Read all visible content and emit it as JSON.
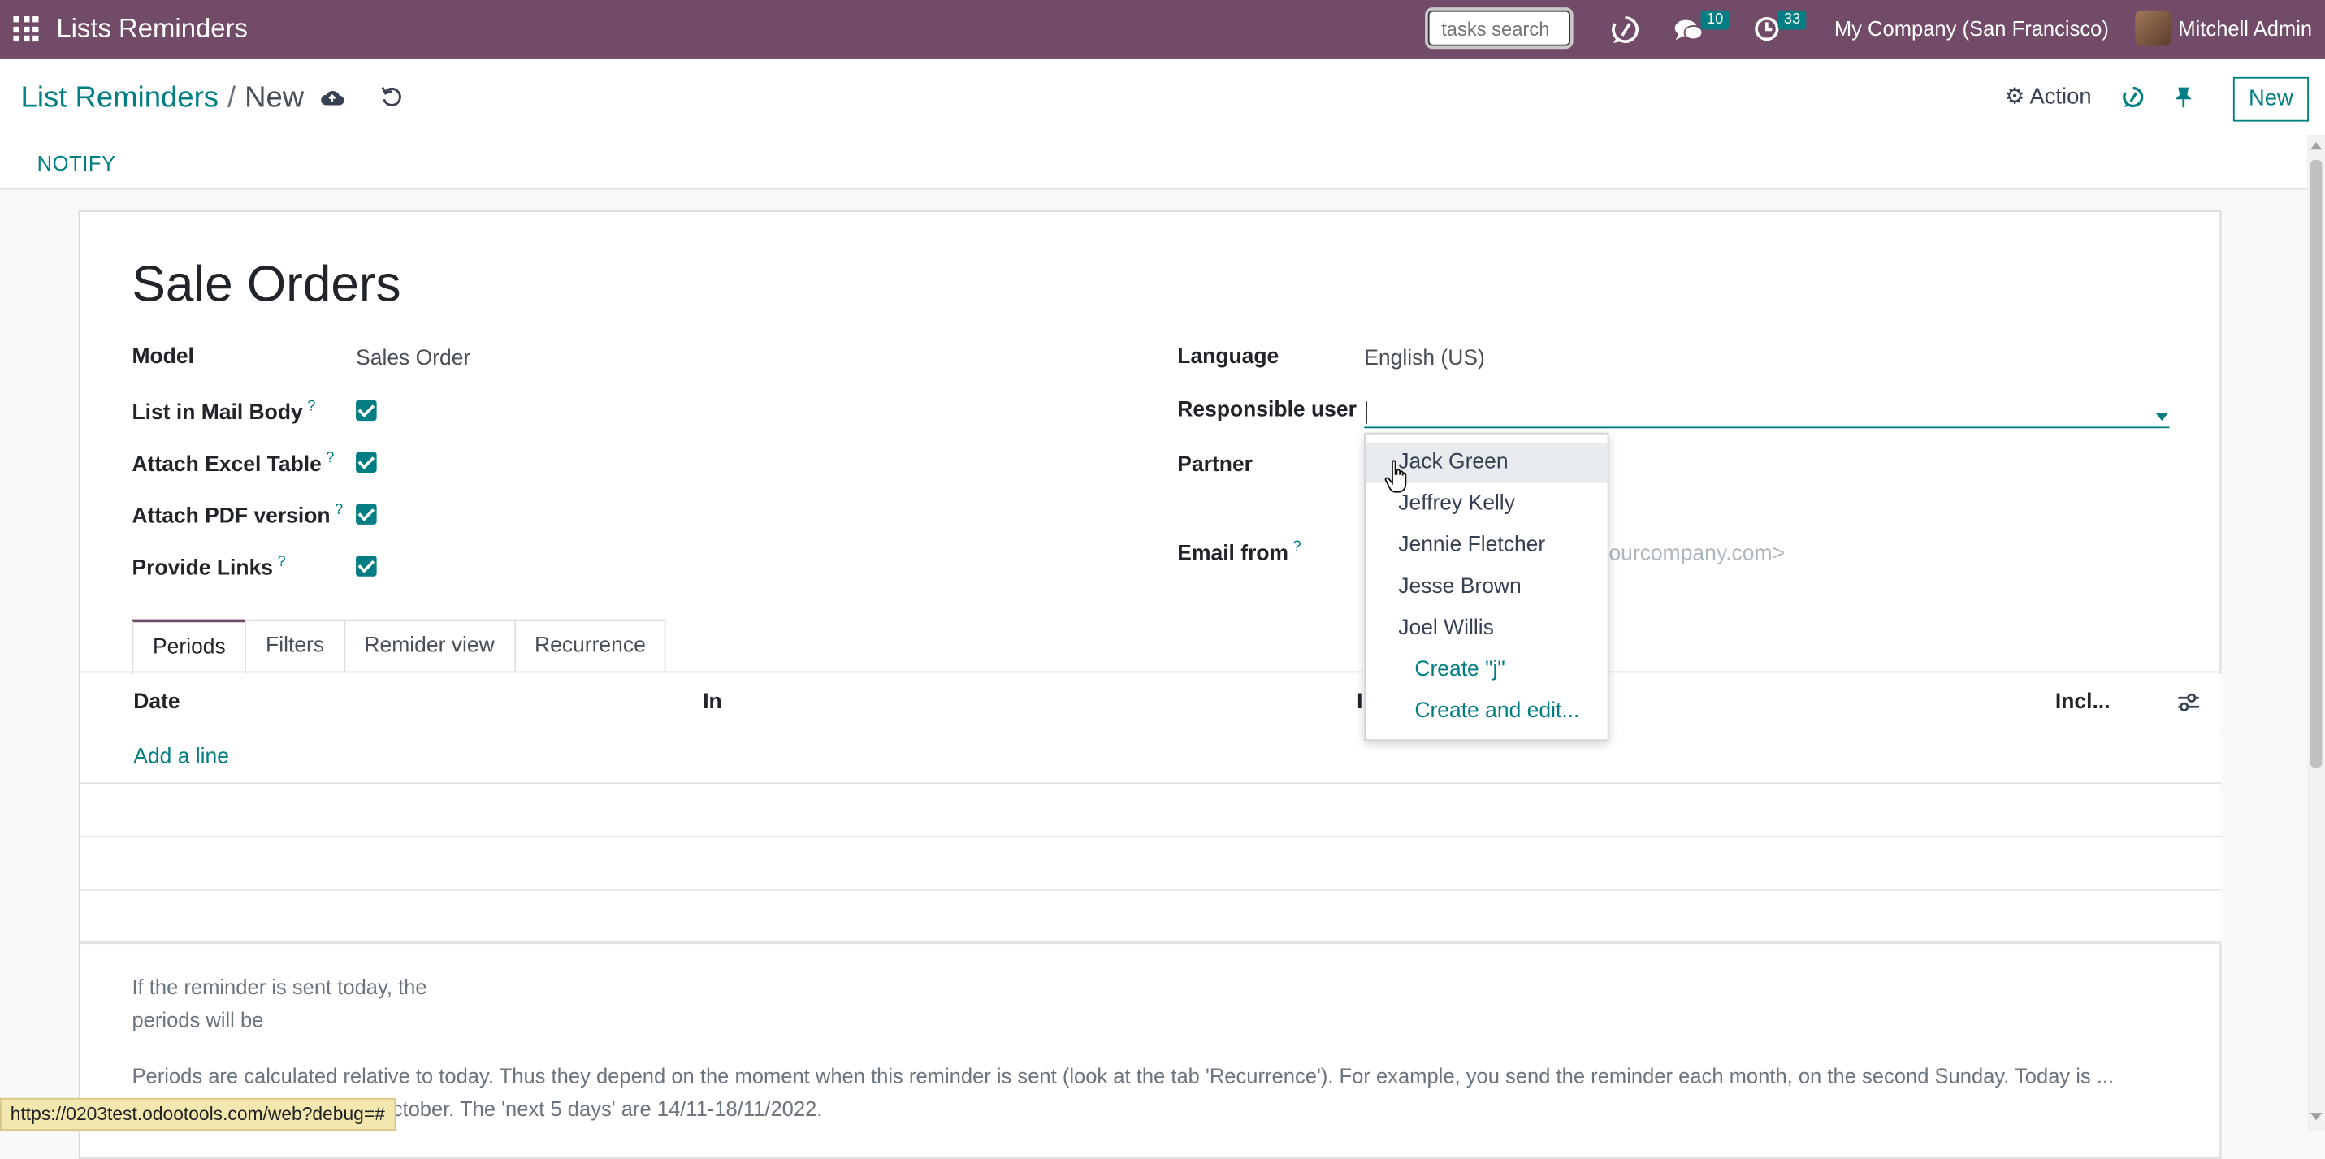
{
  "navbar": {
    "app_title": "Lists Reminders",
    "search_placeholder": "tasks search",
    "messages_count": "10",
    "activities_count": "33",
    "company": "My Company (San Francisco)",
    "user_name": "Mitchell Admin",
    "background_color": "#714b67"
  },
  "control_panel": {
    "breadcrumb_parent": "List Reminders",
    "breadcrumb_separator": "/",
    "breadcrumb_current": "New",
    "action_label": "Action",
    "new_label": "New"
  },
  "statusbar": {
    "notify_label": "NOTIFY"
  },
  "form": {
    "title": "Sale Orders",
    "fields": {
      "model_label": "Model",
      "model_value": "Sales Order",
      "list_in_mail_body_label": "List in Mail Body",
      "attach_excel_label": "Attach Excel Table",
      "attach_pdf_label": "Attach PDF version",
      "provide_links_label": "Provide Links",
      "help_mark": "?",
      "language_label": "Language",
      "language_value": "English (US)",
      "responsible_user_label": "Responsible user",
      "responsible_user_value": "j",
      "partner_label": "Partner",
      "email_from_label": "Email from",
      "email_from_placeholder": "ourcompany.com>"
    },
    "checkboxes": {
      "list_in_mail_body": true,
      "attach_excel": true,
      "attach_pdf": true,
      "provide_links": true
    }
  },
  "tabs": [
    "Periods",
    "Filters",
    "Remider view",
    "Recurrence"
  ],
  "active_tab": "Periods",
  "table": {
    "columns": [
      "Date",
      "In",
      "I",
      "Incl..."
    ],
    "add_line_label": "Add a line"
  },
  "notes": {
    "periods_intro": "If the reminder is sent today, the periods will be",
    "periods_explanation": "Periods are calculated relative to today. Thus they depend on the moment when this reminder is sent (look at the tab 'Recurrence'). For example, you send the reminder each month, on the second Sunday. Today is ... onths' are September and October. The 'next 5 days' are 14/11-18/11/2022."
  },
  "dropdown": {
    "options": [
      "Jack Green",
      "Jeffrey Kelly",
      "Jennie Fletcher",
      "Jesse Brown",
      "Joel Willis"
    ],
    "create_label": "Create \"j\"",
    "create_edit_label": "Create and edit..."
  },
  "status_url": "https://0203test.odootools.com/web?debug=#",
  "accent_color": "#017e84"
}
